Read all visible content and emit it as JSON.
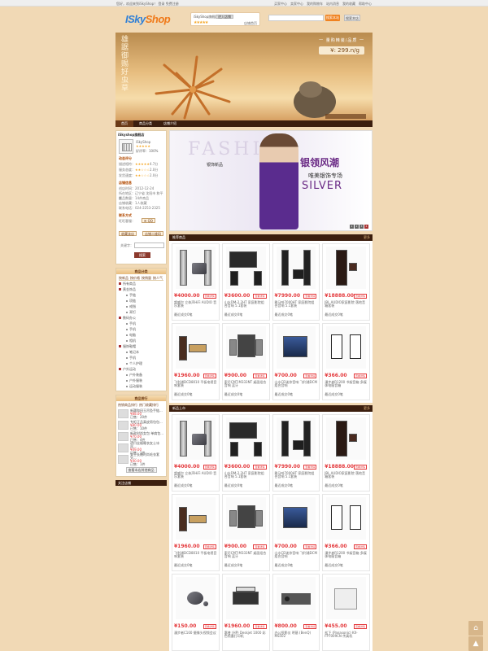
{
  "topbar": {
    "welcome": "您好，欢迎来到iSkyShop！  登录  免费注册",
    "links": [
      "买家中心",
      "卖家中心",
      "我的购物车",
      "站内消息",
      "我的收藏",
      "帮助中心"
    ]
  },
  "header": {
    "logo": "ISkyShop",
    "shop_name": "iSkyShop旗舰店",
    "shop_btn": "进入店铺",
    "shop_link": "店铺首页",
    "search_placeholder": "",
    "search_btn1": "搜索本站",
    "search_btn2": "搜索本店"
  },
  "banner": {
    "vertical": "雄踞御赐好虫草",
    "label": "一 量购精装/品质 一",
    "price": "¥: 299.n/g"
  },
  "nav": [
    "首页",
    "商品分类",
    "店铺介绍"
  ],
  "shop": {
    "name": "iSkyshop旗舰店",
    "owner": "iSkyShop",
    "credit": "好评率：100%",
    "rating_title": "动态评分",
    "ratings": [
      {
        "label": "描述相符：",
        "score": "4.7分"
      },
      {
        "label": "服务态度：",
        "score": "2.0分"
      },
      {
        "label": "发货速度：",
        "score": "2.0分"
      }
    ],
    "info_title": "店铺信息",
    "info": [
      "创店时间：2012-12-24",
      "所在地区：辽宁省 沈阳市 和平区",
      "商品数量：14件商品",
      "店铺收藏：1人收藏",
      "联系电话：024-2253-2325"
    ],
    "contact_title": "联系方式",
    "contact": "旺旺客服：",
    "btn_fav": "收藏该店",
    "btn_qr": "店铺二维码",
    "kw_label": "关键字：",
    "search_btn": "搜索"
  },
  "categories": {
    "title": "商品分类",
    "tabs": [
      "按新品",
      "按价格",
      "按销量",
      "按人气"
    ],
    "items": [
      {
        "label": "所有商品",
        "level": 1
      },
      {
        "label": "黄金饰品",
        "level": 1
      },
      {
        "label": "手链",
        "level": 2
      },
      {
        "label": "项链",
        "level": 2
      },
      {
        "label": "戒指",
        "level": 2
      },
      {
        "label": "耳钉",
        "level": 2
      },
      {
        "label": "数码办公",
        "level": 1
      },
      {
        "label": "手机",
        "level": 2
      },
      {
        "label": "手机",
        "level": 2
      },
      {
        "label": "电脑",
        "level": 2
      },
      {
        "label": "相机",
        "level": 2
      },
      {
        "label": "服饰鞋帽",
        "level": 1
      },
      {
        "label": "笔记本",
        "level": 2
      },
      {
        "label": "手机",
        "level": 2
      },
      {
        "label": "个人护理",
        "level": 2
      },
      {
        "label": "户外运动",
        "level": 1
      },
      {
        "label": "户外装备",
        "level": 2
      },
      {
        "label": "户外服装",
        "level": 2
      },
      {
        "label": "运动服装",
        "level": 2
      }
    ]
  },
  "ranking": {
    "title": "商品排行",
    "tabs": [
      "热销商品排行",
      "热门收藏排行"
    ],
    "items": [
      {
        "name": "新疆和田玉吊坠手链...",
        "price": "¥88.00",
        "sales": "已售：20件"
      },
      {
        "name": "专柜正品真皮男包包...",
        "price": "¥80.00",
        "sales": "已售：10件"
      },
      {
        "name": "新款时尚女包 单肩包...",
        "price": "¥70.00",
        "sales": "已售：4件"
      },
      {
        "name": "进口丝缎睡衣女士冰丝...",
        "price": "¥49.00",
        "sales": "已售：1件"
      },
      {
        "name": "女士长袖时尚毛衣套头...",
        "price": "¥40.00",
        "sales": "已售：1件"
      }
    ],
    "more": "查看本店其他商品"
  },
  "sidebar_footer": "关注店铺",
  "promo": {
    "bg": "FASHION",
    "title": "银领风潮",
    "subtitle": "唯美银饰专场",
    "en": "SILVER",
    "left": "银饰新品",
    "dots": [
      "1",
      "2",
      "3",
      "4"
    ]
  },
  "sections": [
    {
      "title": "推荐商品",
      "more": "更多"
    },
    {
      "title": "新品上市",
      "more": "更多"
    }
  ],
  "products_rec": [
    {
      "price": "¥4000.00",
      "tag": "查看详情",
      "desc": "超威尔 立体声HiFi AUDIO 音乐套装",
      "sold": "最近成交0笔"
    },
    {
      "price": "¥3600.00",
      "tag": "查看详情",
      "desc": "山水DM-2.2HT 家庭影院组合音响 5.1套装",
      "sold": "最近成交0笔"
    },
    {
      "price": "¥7990.00",
      "tag": "查看详情",
      "desc": "雅马哈7000HT 家庭影院组合音响 5.1套装",
      "sold": "最近成交0笔"
    },
    {
      "price": "¥18888.00",
      "tag": "查看详情",
      "desc": "JBL AUDIO家庭影院 落地音箱套装",
      "sold": "最近成交0笔"
    },
    {
      "price": "¥1960.00",
      "tag": "查看详情",
      "desc": "飞利浦DCD8010 平板电视音响套装",
      "sold": "最近成交0笔"
    },
    {
      "price": "¥900.00",
      "tag": "查看详情",
      "desc": "索尼CMT-M333NT 桌面组合音响 蓝牙",
      "sold": "最近成交0笔"
    },
    {
      "price": "¥700.00",
      "tag": "查看详情",
      "desc": "山水CD迷你音响 飞利浦DCM组合音响",
      "sold": "最近成交0笔"
    },
    {
      "price": "¥366.00",
      "tag": "查看详情",
      "desc": "漫步者R1200 书架音箱 多媒体电脑音箱",
      "sold": "最近成交0笔"
    }
  ],
  "products_new": [
    {
      "price": "¥4000.00",
      "tag": "查看详情",
      "desc": "超威尔 立体声HiFi AUDIO 音乐套装",
      "sold": "最近成交0笔"
    },
    {
      "price": "¥3600.00",
      "tag": "查看详情",
      "desc": "山水DM-2.2HT 家庭影院组合音响 5.1套装",
      "sold": "最近成交0笔"
    },
    {
      "price": "¥7990.00",
      "tag": "查看详情",
      "desc": "雅马哈7000HT 家庭影院组合音响 5.1套装",
      "sold": "最近成交0笔"
    },
    {
      "price": "¥18888.00",
      "tag": "查看详情",
      "desc": "JBL AUDIO家庭影院 落地音箱套装",
      "sold": "最近成交0笔"
    },
    {
      "price": "¥1960.00",
      "tag": "查看详情",
      "desc": "飞利浦DCD8010 平板电视音响套装",
      "sold": "最近成交0笔"
    },
    {
      "price": "¥900.00",
      "tag": "查看详情",
      "desc": "索尼CMT-M333NT 桌面组合音响 蓝牙",
      "sold": "最近成交0笔"
    },
    {
      "price": "¥700.00",
      "tag": "查看详情",
      "desc": "山水CD迷你音响 飞利浦DCM组合音响",
      "sold": "最近成交0笔"
    },
    {
      "price": "¥366.00",
      "tag": "查看详情",
      "desc": "漫步者R1200 书架音箱 多媒体电脑音箱",
      "sold": "最近成交0笔"
    },
    {
      "price": "¥150.00",
      "tag": "查看详情",
      "desc": "漫步者C100 摄像头视频会议",
      "sold": ""
    },
    {
      "price": "¥1960.00",
      "tag": "查看详情",
      "desc": "惠普 (HP) Deskjet 1000 彩色喷墨打印机",
      "sold": ""
    },
    {
      "price": "¥800.00",
      "tag": "查看详情",
      "desc": "办公投影仪 明基 (BenQ) MS502",
      "sold": ""
    },
    {
      "price": "¥455.00",
      "tag": "查看详情",
      "desc": "松下 (Panasonic) KX-FP7009CN 传真机",
      "sold": ""
    }
  ],
  "float": {
    "top": "⌂",
    "up": "▲"
  }
}
